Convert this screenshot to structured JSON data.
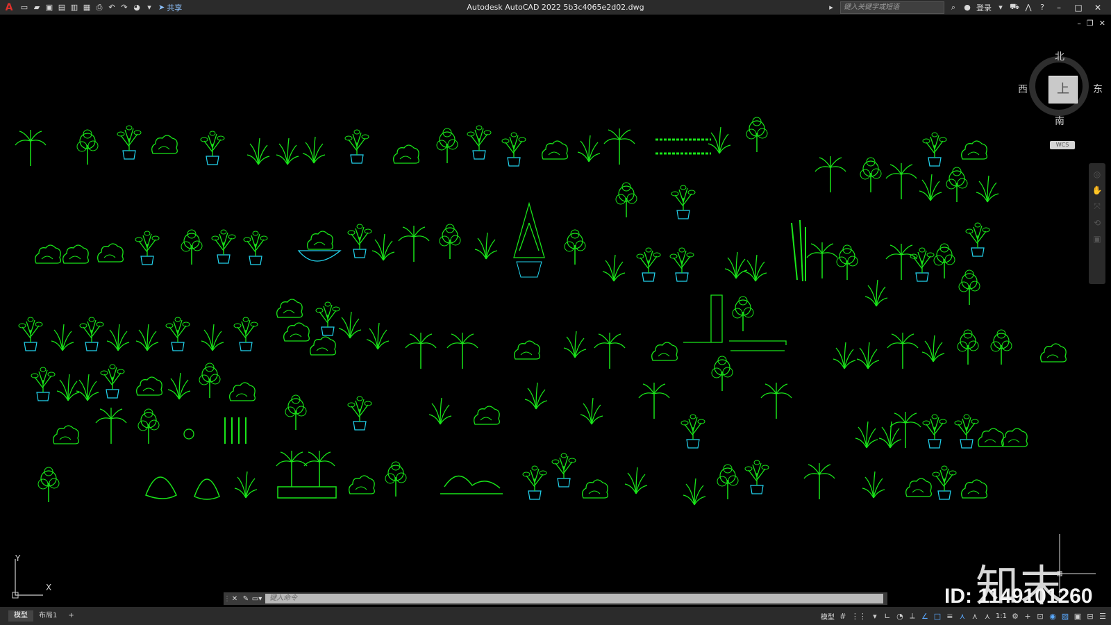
{
  "titlebar": {
    "app_logo": "A",
    "share_label": "共享",
    "title": "Autodesk AutoCAD 2022    5b3c4065e2d02.dwg",
    "search_placeholder": "键入关键字或短语",
    "login_label": "登录"
  },
  "viewcube": {
    "north": "北",
    "south": "南",
    "east": "东",
    "west": "西",
    "face": "上",
    "wcs": "WCS"
  },
  "ucs": {
    "x": "X",
    "y": "Y"
  },
  "watermark": {
    "logo": "知末",
    "id": "ID: 1149101260"
  },
  "command_line": {
    "placeholder": "键入命令"
  },
  "status_bar": {
    "tabs": [
      {
        "label": "模型",
        "active": true
      },
      {
        "label": "布局1",
        "active": false
      }
    ],
    "add_tab": "+",
    "model_label": "模型",
    "scale_label": "1:1"
  },
  "colors": {
    "plant_green": "#19e619",
    "pot_cyan": "#22d4ee",
    "background": "#000000",
    "chrome": "#2b2b2b"
  },
  "drawing": {
    "content": "plant-symbol-library"
  }
}
